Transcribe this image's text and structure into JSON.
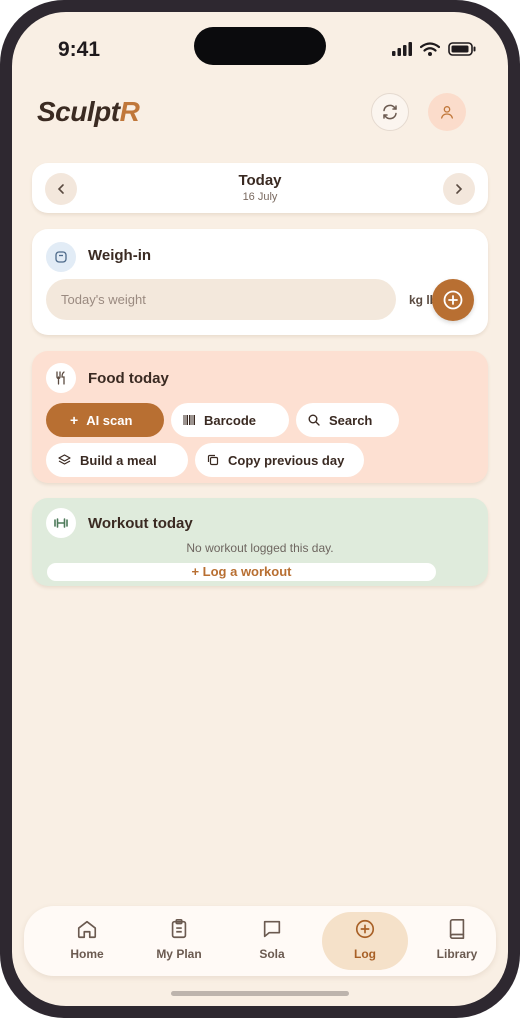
{
  "status_bar": {
    "time": "9:41"
  },
  "header": {
    "logo_main": "Sculpt",
    "logo_accent": "R"
  },
  "date_nav": {
    "title": "Today",
    "date": "16 July"
  },
  "weigh_in": {
    "title": "Weigh-in",
    "placeholder": "Today's weight",
    "unit_label": "kg lb"
  },
  "food": {
    "title": "Food today",
    "chips": [
      "AI scan",
      "Barcode",
      "Search",
      "Build a meal",
      "Copy previous day"
    ]
  },
  "workout": {
    "title": "Workout today",
    "empty_message": "No workout logged this day.",
    "log_button": "+ Log a workout"
  },
  "tabs": [
    {
      "label": "Home",
      "icon": "home-icon"
    },
    {
      "label": "My Plan",
      "icon": "clipboard-icon"
    },
    {
      "label": "Sola",
      "icon": "chat-icon"
    },
    {
      "label": "Log",
      "icon": "plus-circle-icon",
      "active": true
    },
    {
      "label": "Library",
      "icon": "book-icon"
    }
  ],
  "colors": {
    "background": "#f9efe4",
    "accent": "#b86f32",
    "food_card": "#fde0d2",
    "workout_card": "#dfebdc"
  }
}
